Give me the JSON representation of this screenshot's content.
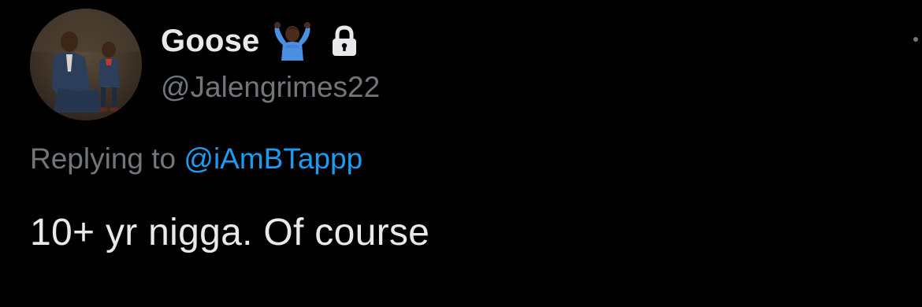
{
  "tweet": {
    "display_name": "Goose",
    "handle": "@Jalengrimes22",
    "replying_prefix": "Replying to",
    "replying_to": "@iAmBTappp",
    "text": "10+ yr nigga. Of course"
  },
  "icons": {
    "name_emoji": "person-shrugging-emoji-icon",
    "protected": "lock-icon",
    "more": "more-options-icon"
  },
  "colors": {
    "background": "#000000",
    "primary_text": "#e7e9ea",
    "secondary_text": "#71767b",
    "link": "#1d9bf0"
  }
}
